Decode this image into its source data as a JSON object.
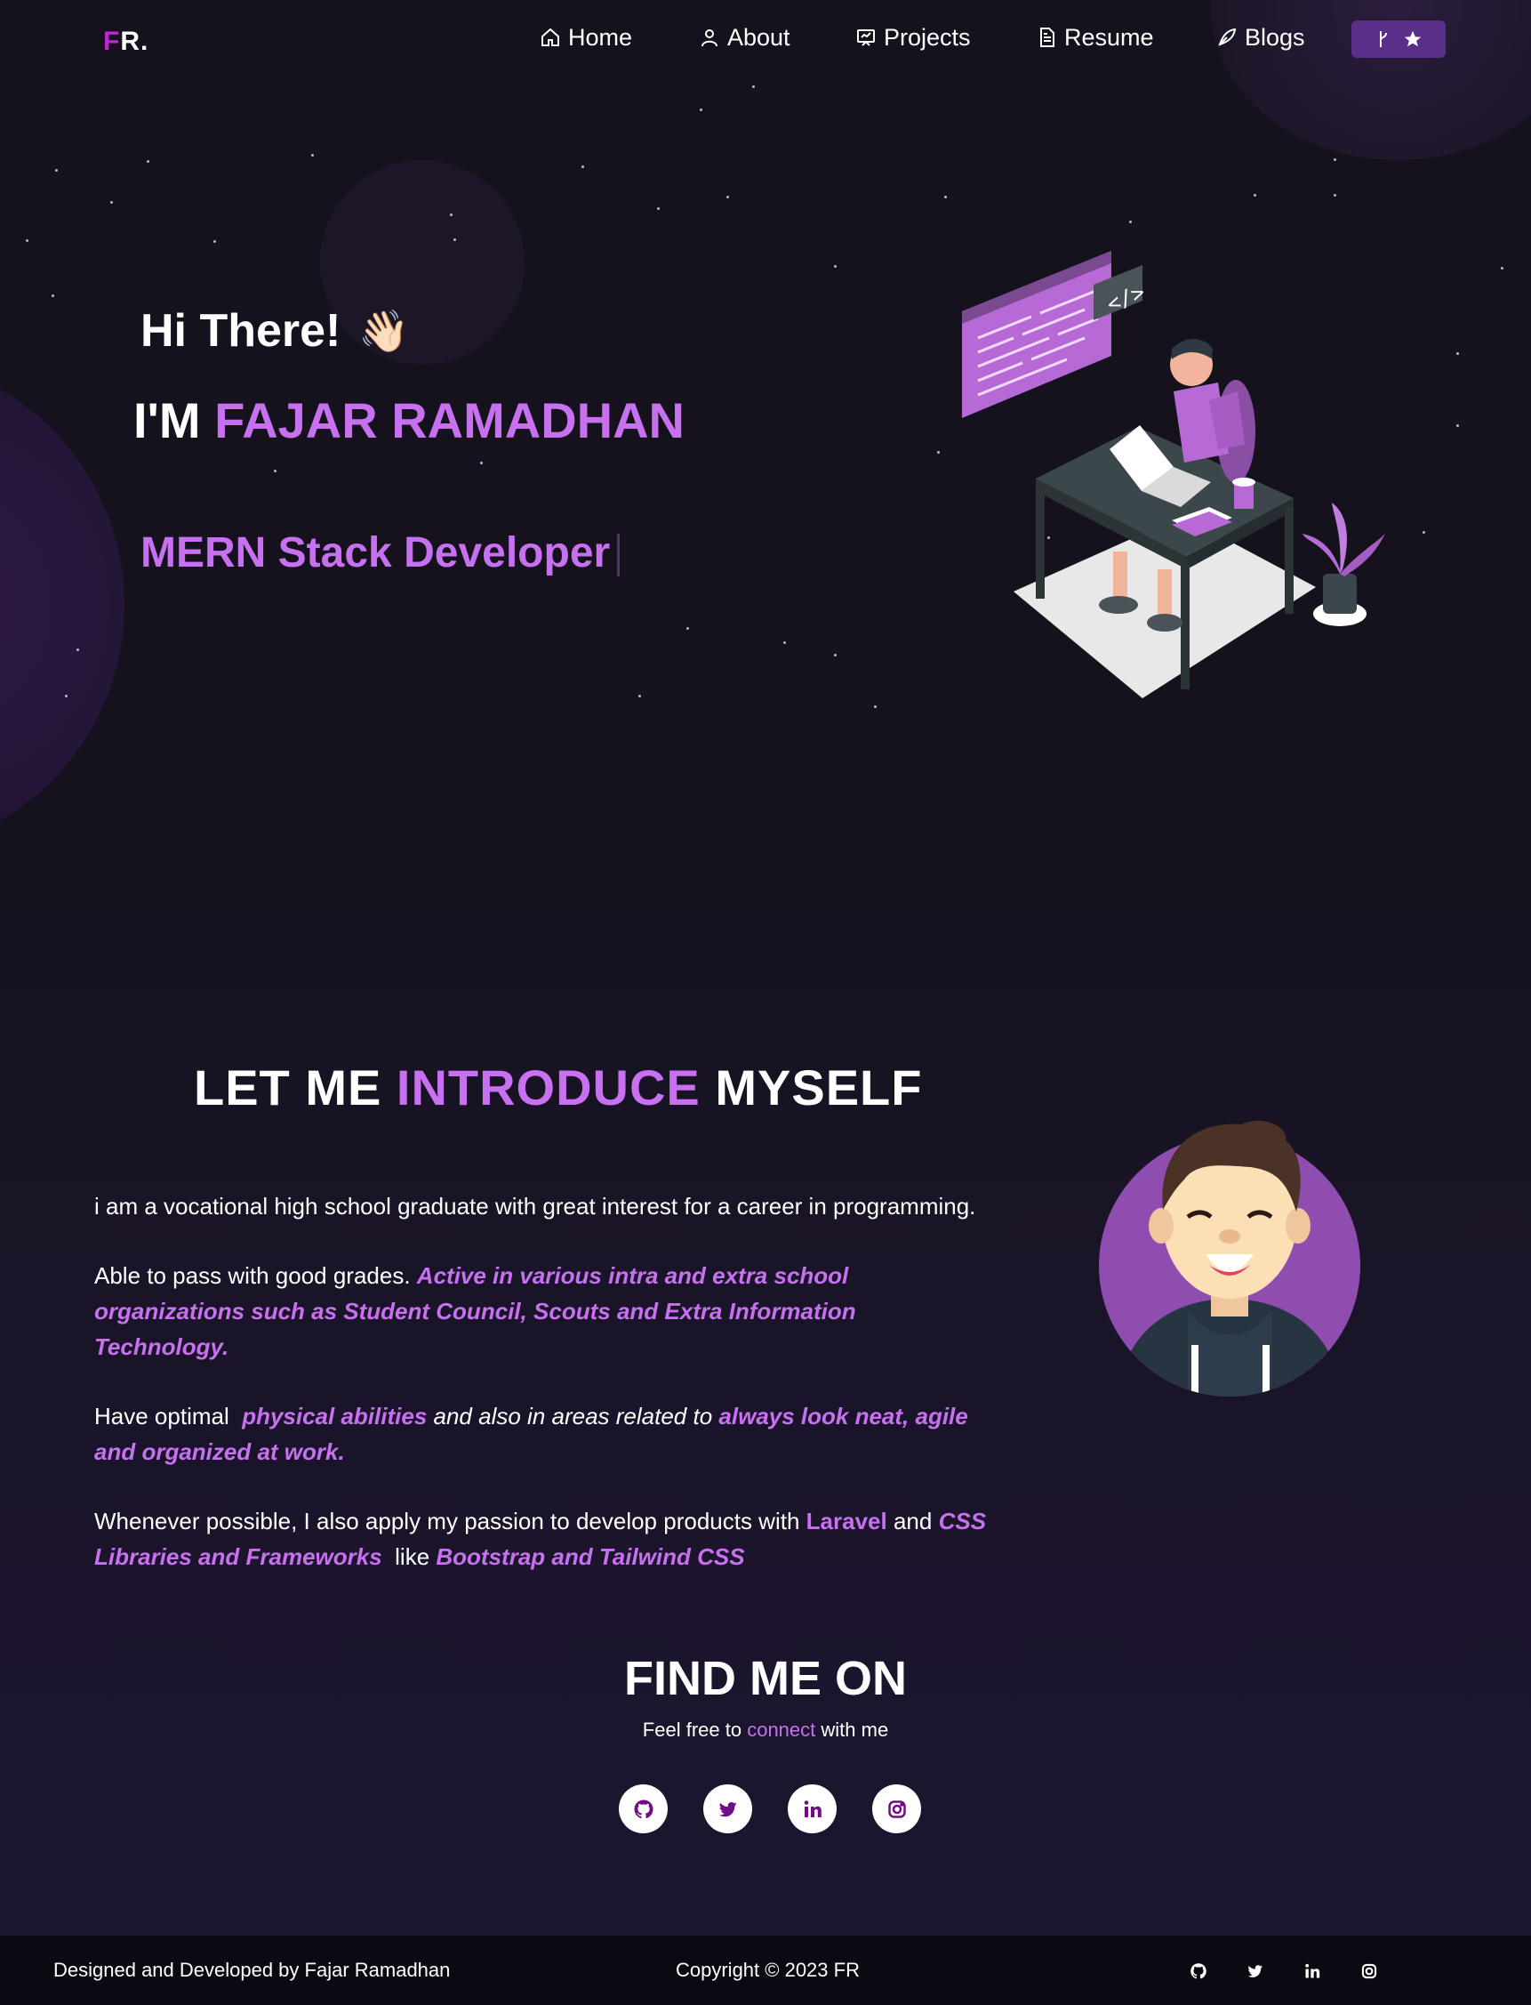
{
  "nav": {
    "logo_first": "F",
    "logo_rest": "R.",
    "items": [
      {
        "label": "Home",
        "icon": "home-icon"
      },
      {
        "label": "About",
        "icon": "user-icon"
      },
      {
        "label": "Projects",
        "icon": "projects-icon"
      },
      {
        "label": "Resume",
        "icon": "document-icon"
      },
      {
        "label": "Blogs",
        "icon": "blogs-icon"
      }
    ],
    "github_button_icons": [
      "fork-icon",
      "star-icon"
    ]
  },
  "hero": {
    "greeting": "Hi There!",
    "wave_emoji": "👋🏻",
    "name_prefix": "I'M",
    "name": "FAJAR RAMADHAN",
    "role": "MERN Stack Developer"
  },
  "intro": {
    "title_a": "LET ME",
    "title_hl": "INTRODUCE",
    "title_b": "MYSELF",
    "p1": "i am a vocational high school graduate with great interest for a career in programming.",
    "p2_a": "Able to pass with good grades.",
    "p2_hl": "Active in various intra and extra school organizations such as Student Council, Scouts and Extra Information Technology.",
    "p3_a": "Have optimal",
    "p3_hl1": "physical abilities",
    "p3_b": "and also in areas related to",
    "p3_hl2": "always look neat, agile and organized at work.",
    "p4_a": "Whenever possible, I also apply my passion to develop products with",
    "p4_hl1": "Laravel",
    "p4_b": "and",
    "p4_hl2": "CSS Libraries and Frameworks",
    "p4_c": "like",
    "p4_hl3": "Bootstrap and Tailwind CSS"
  },
  "find": {
    "title": "FIND ME ON",
    "sub_a": "Feel free to",
    "sub_hl": "connect",
    "sub_b": "with me",
    "socials": [
      "github-icon",
      "twitter-icon",
      "linkedin-icon",
      "instagram-icon"
    ]
  },
  "footer": {
    "left": "Designed and Developed by Fajar Ramadhan",
    "mid": "Copyright © 2023 FR"
  },
  "colors": {
    "accent": "#c770f0",
    "button": "#5a2f8a",
    "background": "#16121d",
    "footer": "#0c0913"
  }
}
